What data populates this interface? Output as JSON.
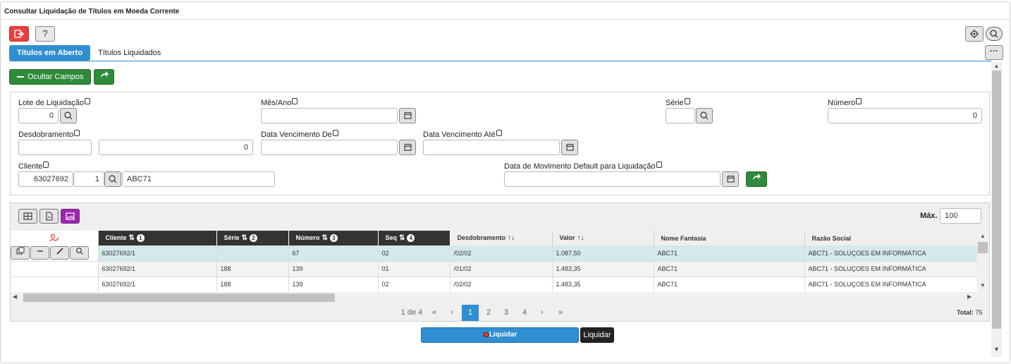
{
  "window": {
    "title": "Consultar Liquidação de Títulos em Moeda Corrente"
  },
  "toolbar": {
    "exit_icon": "exit-icon",
    "help_label": "?",
    "gear_icon": "gear-icon",
    "search_icon": "search-icon",
    "more_label": "···"
  },
  "tabs": [
    {
      "label": "Títulos em Aberto",
      "active": true
    },
    {
      "label": "Títulos Liquidados",
      "active": false
    }
  ],
  "actions": {
    "hide_fields_label": "Ocultar Campos"
  },
  "form": {
    "lote": {
      "label": "Lote de Liquidação",
      "value": "0"
    },
    "mes_ano": {
      "label": "Mês/Ano",
      "value": ""
    },
    "serie": {
      "label": "Série",
      "value": ""
    },
    "numero": {
      "label": "Número",
      "value": "0"
    },
    "desdobramento": {
      "label": "Desdobramento",
      "value": "",
      "value2": "0"
    },
    "venc_de": {
      "label": "Data Vencimento De",
      "value": ""
    },
    "venc_ate": {
      "label": "Data Vencimento Até",
      "value": ""
    },
    "cliente": {
      "label": "Cliente",
      "code": "63027692",
      "seq": "1",
      "name": "ABC71"
    },
    "data_mov": {
      "label": "Data de Movimento Default para Liquidação",
      "value": ""
    }
  },
  "grid": {
    "max_label": "Máx.",
    "max_value": "100",
    "columns": [
      "Cliente",
      "Série",
      "Número",
      "Seq",
      "Desdobramento",
      "Valor",
      "Nome Fantasia",
      "Razão Social"
    ],
    "sort_order": [
      "1",
      "2",
      "3",
      "4"
    ],
    "rows": [
      [
        "63027692/1",
        "",
        "67",
        "02",
        "/02/02",
        "1.087,50",
        "ABC71",
        "ABC71 - SOLUÇOES EM INFORMÁTICA"
      ],
      [
        "63027692/1",
        "188",
        "139",
        "01",
        "/01/02",
        "1.483,35",
        "ABC71",
        "ABC71 - SOLUÇOES EM INFORMÁTICA"
      ],
      [
        "63027692/1",
        "188",
        "139",
        "02",
        "/02/02",
        "1.483,35",
        "ABC71",
        "ABC71 - SOLUÇOES EM INFORMÁTICA"
      ]
    ]
  },
  "pager": {
    "info": "1 de 4",
    "first": "«",
    "prev": "‹",
    "pages": [
      "1",
      "2",
      "3",
      "4"
    ],
    "next": "›",
    "last": "»",
    "total_label": "Total:",
    "total_value": "75"
  },
  "footer": {
    "liquidar_label": "Liquidar",
    "tooltip": "Liquidar"
  },
  "colors": {
    "primary": "#2f8fd0",
    "success": "#2e8b3a",
    "danger": "#e8413d",
    "accent": "#9c27b0",
    "header_dark": "#333333",
    "selected_row": "#d4e9ec"
  }
}
